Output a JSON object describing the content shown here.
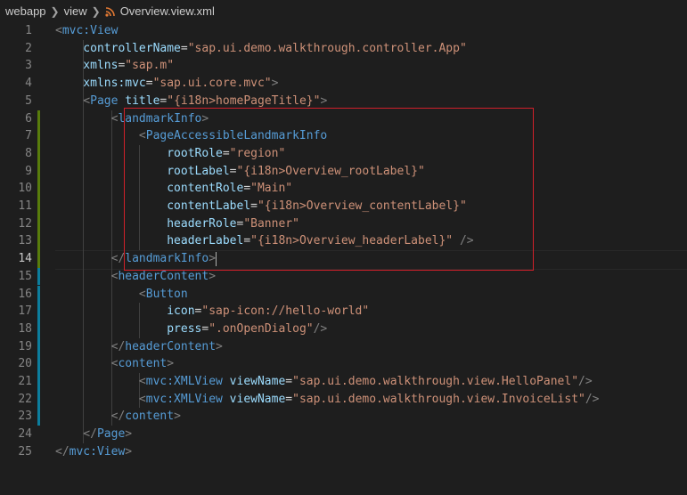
{
  "breadcrumb": {
    "items": [
      "webapp",
      "view",
      "Overview.view.xml"
    ],
    "file_icon": "rss-feed-icon"
  },
  "editor": {
    "active_line": 14,
    "lines": [
      {
        "n": "1",
        "tokens": [
          [
            "t",
            "<"
          ],
          [
            "tg",
            "mvc:View"
          ]
        ]
      },
      {
        "n": "2",
        "tokens": [
          [
            "at",
            "    controllerName"
          ],
          [
            "d",
            "="
          ],
          [
            "vl",
            "\"sap.ui.demo.walkthrough.controller.App\""
          ]
        ]
      },
      {
        "n": "3",
        "tokens": [
          [
            "at",
            "    xmlns"
          ],
          [
            "d",
            "="
          ],
          [
            "vl",
            "\"sap.m\""
          ]
        ]
      },
      {
        "n": "4",
        "tokens": [
          [
            "at",
            "    xmlns:mvc"
          ],
          [
            "d",
            "="
          ],
          [
            "vl",
            "\"sap.ui.core.mvc\""
          ],
          [
            "t",
            ">"
          ]
        ]
      },
      {
        "n": "5",
        "tokens": [
          [
            "t",
            "    <"
          ],
          [
            "tg",
            "Page"
          ],
          [
            "d",
            " "
          ],
          [
            "at",
            "title"
          ],
          [
            "d",
            "="
          ],
          [
            "vl",
            "\"{i18n>homePageTitle}\""
          ],
          [
            "t",
            ">"
          ]
        ]
      },
      {
        "n": "6",
        "tokens": [
          [
            "t",
            "        <"
          ],
          [
            "tg",
            "landmarkInfo"
          ],
          [
            "t",
            ">"
          ]
        ]
      },
      {
        "n": "7",
        "tokens": [
          [
            "t",
            "            <"
          ],
          [
            "tg",
            "PageAccessibleLandmarkInfo"
          ]
        ]
      },
      {
        "n": "8",
        "tokens": [
          [
            "at",
            "                rootRole"
          ],
          [
            "d",
            "="
          ],
          [
            "vl",
            "\"region\""
          ]
        ]
      },
      {
        "n": "9",
        "tokens": [
          [
            "at",
            "                rootLabel"
          ],
          [
            "d",
            "="
          ],
          [
            "vl",
            "\"{i18n>Overview_rootLabel}\""
          ]
        ]
      },
      {
        "n": "10",
        "tokens": [
          [
            "at",
            "                contentRole"
          ],
          [
            "d",
            "="
          ],
          [
            "vl",
            "\"Main\""
          ]
        ]
      },
      {
        "n": "11",
        "tokens": [
          [
            "at",
            "                contentLabel"
          ],
          [
            "d",
            "="
          ],
          [
            "vl",
            "\"{i18n>Overview_contentLabel}\""
          ]
        ]
      },
      {
        "n": "12",
        "tokens": [
          [
            "at",
            "                headerRole"
          ],
          [
            "d",
            "="
          ],
          [
            "vl",
            "\"Banner\""
          ]
        ]
      },
      {
        "n": "13",
        "tokens": [
          [
            "at",
            "                headerLabel"
          ],
          [
            "d",
            "="
          ],
          [
            "vl",
            "\"{i18n>Overview_headerLabel}\""
          ],
          [
            "t",
            " />"
          ]
        ]
      },
      {
        "n": "14",
        "tokens": [
          [
            "t",
            "        </"
          ],
          [
            "tg",
            "landmarkInfo"
          ],
          [
            "t",
            ">"
          ]
        ]
      },
      {
        "n": "15",
        "tokens": [
          [
            "t",
            "        <"
          ],
          [
            "tg",
            "headerContent"
          ],
          [
            "t",
            ">"
          ]
        ]
      },
      {
        "n": "16",
        "tokens": [
          [
            "t",
            "            <"
          ],
          [
            "tg",
            "Button"
          ]
        ]
      },
      {
        "n": "17",
        "tokens": [
          [
            "at",
            "                icon"
          ],
          [
            "d",
            "="
          ],
          [
            "vl",
            "\"sap-icon://hello-world\""
          ]
        ]
      },
      {
        "n": "18",
        "tokens": [
          [
            "at",
            "                press"
          ],
          [
            "d",
            "="
          ],
          [
            "vl",
            "\".onOpenDialog\""
          ],
          [
            "t",
            "/>"
          ]
        ]
      },
      {
        "n": "19",
        "tokens": [
          [
            "t",
            "        </"
          ],
          [
            "tg",
            "headerContent"
          ],
          [
            "t",
            ">"
          ]
        ]
      },
      {
        "n": "20",
        "tokens": [
          [
            "t",
            "        <"
          ],
          [
            "tg",
            "content"
          ],
          [
            "t",
            ">"
          ]
        ]
      },
      {
        "n": "21",
        "tokens": [
          [
            "t",
            "            <"
          ],
          [
            "tg",
            "mvc:XMLView"
          ],
          [
            "d",
            " "
          ],
          [
            "at",
            "viewName"
          ],
          [
            "d",
            "="
          ],
          [
            "vl",
            "\"sap.ui.demo.walkthrough.view.HelloPanel\""
          ],
          [
            "t",
            "/>"
          ]
        ]
      },
      {
        "n": "22",
        "tokens": [
          [
            "t",
            "            <"
          ],
          [
            "tg",
            "mvc:XMLView"
          ],
          [
            "d",
            " "
          ],
          [
            "at",
            "viewName"
          ],
          [
            "d",
            "="
          ],
          [
            "vl",
            "\"sap.ui.demo.walkthrough.view.InvoiceList\""
          ],
          [
            "t",
            "/>"
          ]
        ]
      },
      {
        "n": "23",
        "tokens": [
          [
            "t",
            "        </"
          ],
          [
            "tg",
            "content"
          ],
          [
            "t",
            ">"
          ]
        ]
      },
      {
        "n": "24",
        "tokens": [
          [
            "t",
            "    </"
          ],
          [
            "tg",
            "Page"
          ],
          [
            "t",
            ">"
          ]
        ]
      },
      {
        "n": "25",
        "tokens": [
          [
            "t",
            "</"
          ],
          [
            "tg",
            "mvc:View"
          ],
          [
            "t",
            ">"
          ]
        ]
      }
    ]
  }
}
